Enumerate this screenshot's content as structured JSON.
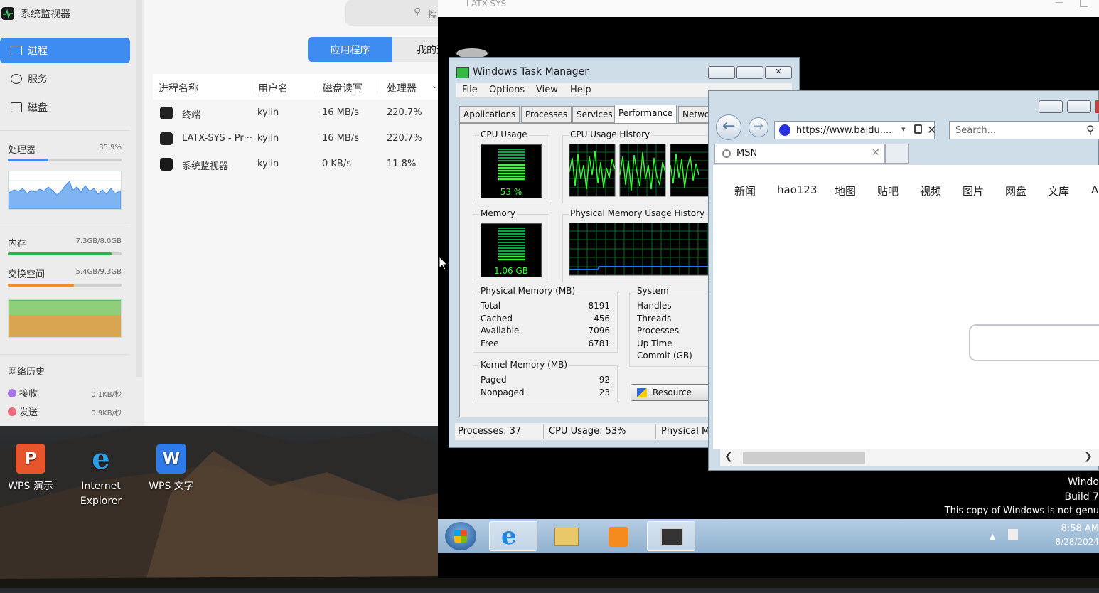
{
  "sysmon": {
    "title": "系统监视器",
    "nav": [
      {
        "label": "进程"
      },
      {
        "label": "服务"
      },
      {
        "label": "磁盘"
      }
    ],
    "cpu": {
      "label": "处理器",
      "value": "35.9%",
      "fraction": 0.359,
      "color": "#3e8cf2"
    },
    "mem": {
      "label": "内存",
      "value": "7.3GB/8.0GB",
      "fraction": 0.9125,
      "color": "#2ab34a"
    },
    "swap": {
      "label": "交换空间",
      "value": "5.4GB/9.3GB",
      "fraction": 0.58,
      "color": "#f08c2c"
    },
    "net": {
      "label": "网络历史",
      "recv_label": "接收",
      "recv_val": "0.1KB/秒",
      "send_label": "发送",
      "send_val": "0.9KB/秒"
    },
    "search_placeholder": "搜",
    "tabs": [
      {
        "label": "应用程序"
      },
      {
        "label": "我的进"
      }
    ],
    "columns": [
      "进程名称",
      "用户名",
      "磁盘读写",
      "处理器"
    ],
    "rows": [
      {
        "name": "终端",
        "user": "kylin",
        "disk": "16 MB/s",
        "cpu": "220.7%"
      },
      {
        "name": "LATX-SYS - Pr···",
        "user": "kylin",
        "disk": "16 MB/s",
        "cpu": "220.7%"
      },
      {
        "name": "系统监视器",
        "user": "kylin",
        "disk": "0 KB/s",
        "cpu": "11.8%"
      }
    ]
  },
  "desktop_icons": [
    {
      "label": "WPS 演示",
      "icon": "wps-presentation-icon",
      "color": "#e8552d"
    },
    {
      "label": "Internet\nExplorer",
      "icon": "ie-icon",
      "color": "#1e88e5"
    },
    {
      "label": "WPS 文字",
      "icon": "wps-writer-icon",
      "color": "#2d7ae8"
    }
  ],
  "vm": {
    "title": "LATX-SYS",
    "taskmgr": {
      "title": "Windows Task Manager",
      "menu": [
        "File",
        "Options",
        "View",
        "Help"
      ],
      "tabs": [
        "Applications",
        "Processes",
        "Services",
        "Performance",
        "Netwo"
      ],
      "cpu_usage_label": "CPU Usage",
      "cpu_usage_val": "53 %",
      "cpu_hist_label": "CPU Usage History",
      "mem_label": "Memory",
      "mem_val": "1.06 GB",
      "mem_hist_label": "Physical Memory Usage History",
      "phys": {
        "title": "Physical Memory (MB)",
        "rows": [
          [
            "Total",
            "8191"
          ],
          [
            "Cached",
            "456"
          ],
          [
            "Available",
            "7096"
          ],
          [
            "Free",
            "6781"
          ]
        ]
      },
      "kernel": {
        "title": "Kernel Memory (MB)",
        "rows": [
          [
            "Paged",
            "92"
          ],
          [
            "Nonpaged",
            "23"
          ]
        ]
      },
      "system": {
        "title": "System",
        "rows": [
          "Handles",
          "Threads",
          "Processes",
          "Up Time",
          "Commit (GB)"
        ]
      },
      "resource_btn": "Resource",
      "status": [
        "Processes: 37",
        "CPU Usage: 53%",
        "Physical M"
      ]
    },
    "ie": {
      "url": "https://www.baidu....",
      "search_placeholder": "Search...",
      "tab_title": "MSN",
      "links": [
        "新闻",
        "hao123",
        "地图",
        "贴吧",
        "视频",
        "图片",
        "网盘",
        "文库",
        "A"
      ]
    },
    "watermark": [
      "Windo",
      "Build 7",
      "This copy of Windows is not genu"
    ],
    "clock": {
      "time": "8:58 AM",
      "date": "8/28/2024"
    }
  }
}
